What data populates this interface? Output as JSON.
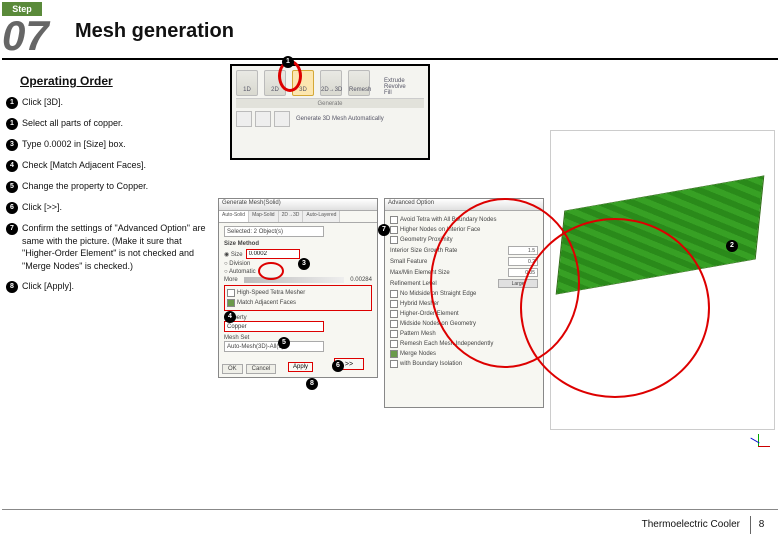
{
  "step": {
    "label": "Step",
    "number": "07",
    "title": "Mesh generation"
  },
  "opOrder": "Operating Order",
  "instructions": [
    {
      "n": "1",
      "t": "Click [3D]."
    },
    {
      "n": "1",
      "t": "Select all parts of copper."
    },
    {
      "n": "3",
      "t": "Type 0.0002 in [Size] box."
    },
    {
      "n": "4",
      "t": "Check [Match Adjacent Faces]."
    },
    {
      "n": "5",
      "t": "Change the property to Copper."
    },
    {
      "n": "6",
      "t": "Click [>>]."
    },
    {
      "n": "7",
      "t": "Confirm the settings of \"Advanced Option\" are same with the picture. (Make it sure that \"Higher-Order Element\" is not checked and \"Merge Nodes\" is checked.)"
    },
    {
      "n": "8",
      "t": "Click [Apply]."
    }
  ],
  "ribbon": {
    "icons": [
      "1D",
      "2D",
      "3D",
      "2D→3D",
      "Remesh"
    ],
    "right_items": [
      "Extrude",
      "Revolve",
      "Fill"
    ],
    "sep": "Generate",
    "gen_label": "Generate 3D Mesh Automatically"
  },
  "dlg1": {
    "title": "Generate Mesh(Solid)",
    "tabs": [
      "Auto-Solid",
      "Map-Solid",
      "2D→3D",
      "Auto-Layered"
    ],
    "selected": "Selected: 2 Object(s)",
    "size_method_label": "Size Method",
    "size_radio": "Size",
    "size_val": "0.0002",
    "div_radio": "Division",
    "auto_radio": "Automatic",
    "more_label": "More",
    "less_val": "0.00284",
    "hi_speed": "High-Speed Tetra Mesher",
    "match": "Match Adjacent Faces",
    "prop_label": "Property",
    "prop": "Copper",
    "meshset_label": "Mesh Set",
    "meshset": "Auto-Mesh(3D)-All(1)",
    "btns": [
      "OK",
      "Cancel",
      "Apply"
    ],
    "chev": ">>"
  },
  "dlg2": {
    "title": "Advanced Option",
    "avoid": "Avoid Tetra with All Boundary Nodes",
    "interior": "Higher Nodes on Interior Face",
    "geom_rate": "Geometry Proximity",
    "size_growth": "Interior Size Growth Rate",
    "size_growth_v": "1.5",
    "small_feat": "Small Feature",
    "small_v": "0.2",
    "maxmin": "Max/Min Element Size",
    "maxmin_v": "0.05",
    "refine": "Refinement Level",
    "refine_v": "Large",
    "midside": "No Midside on Straight Edge",
    "hyb": "Hybrid Mesher",
    "ho": "Higher-Order Element",
    "midnode": "Midside Nodes on Geometry",
    "pattern": "Pattern Mesh",
    "indep": "Remesh Each Mesh Independently",
    "merge": "Merge Nodes",
    "boundary": "with Boundary Isolation"
  },
  "callouts": {
    "c1": "1",
    "c2": "2",
    "c3": "3",
    "c4": "4",
    "c5": "5",
    "c6": "6",
    "c7": "7",
    "c8": "8"
  },
  "footer": {
    "left": "Thermoelectric Cooler",
    "page": "8"
  }
}
